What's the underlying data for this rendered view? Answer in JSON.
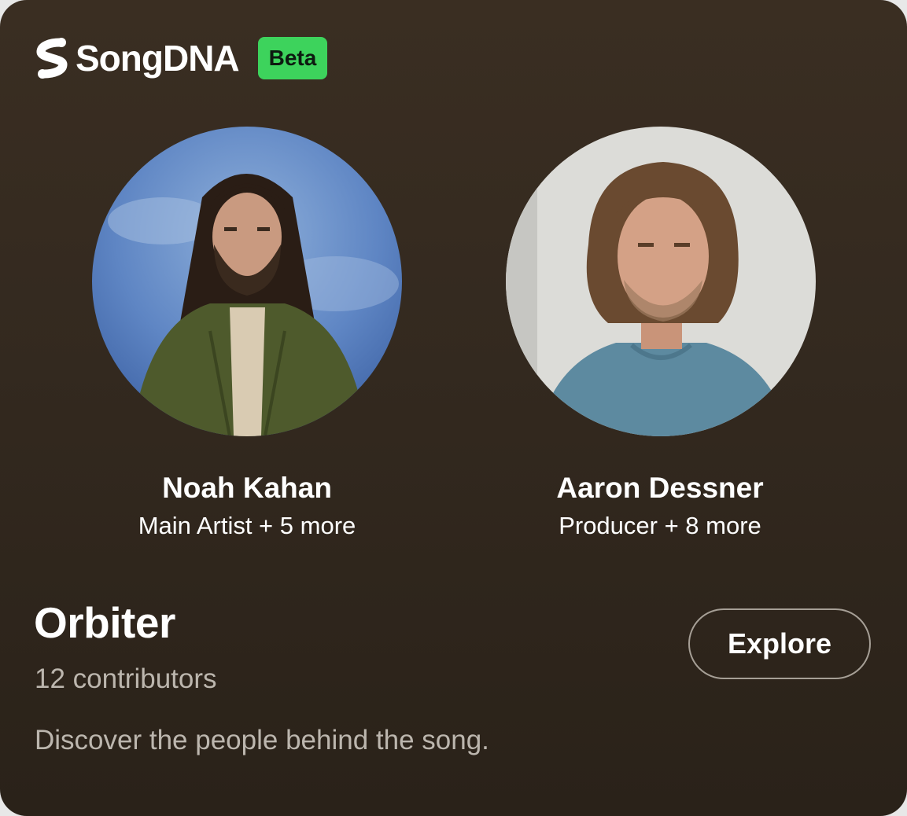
{
  "brand": {
    "logo_icon": "songdna-logo-icon",
    "name": "SongDNA",
    "badge": "Beta",
    "badge_color": "#3dd35c"
  },
  "people": [
    {
      "name": "Noah Kahan",
      "role": "Main Artist + 5 more",
      "avatar_icon": "artist-photo"
    },
    {
      "name": "Aaron Dessner",
      "role": "Producer + 8 more",
      "avatar_icon": "producer-photo"
    }
  ],
  "song": {
    "title": "Orbiter",
    "contributors": "12 contributors",
    "tagline": "Discover the people behind the song."
  },
  "actions": {
    "explore_label": "Explore"
  },
  "colors": {
    "card_background": "#33291f",
    "secondary_text": "#bcb6ae",
    "button_border": "#a69f96"
  }
}
